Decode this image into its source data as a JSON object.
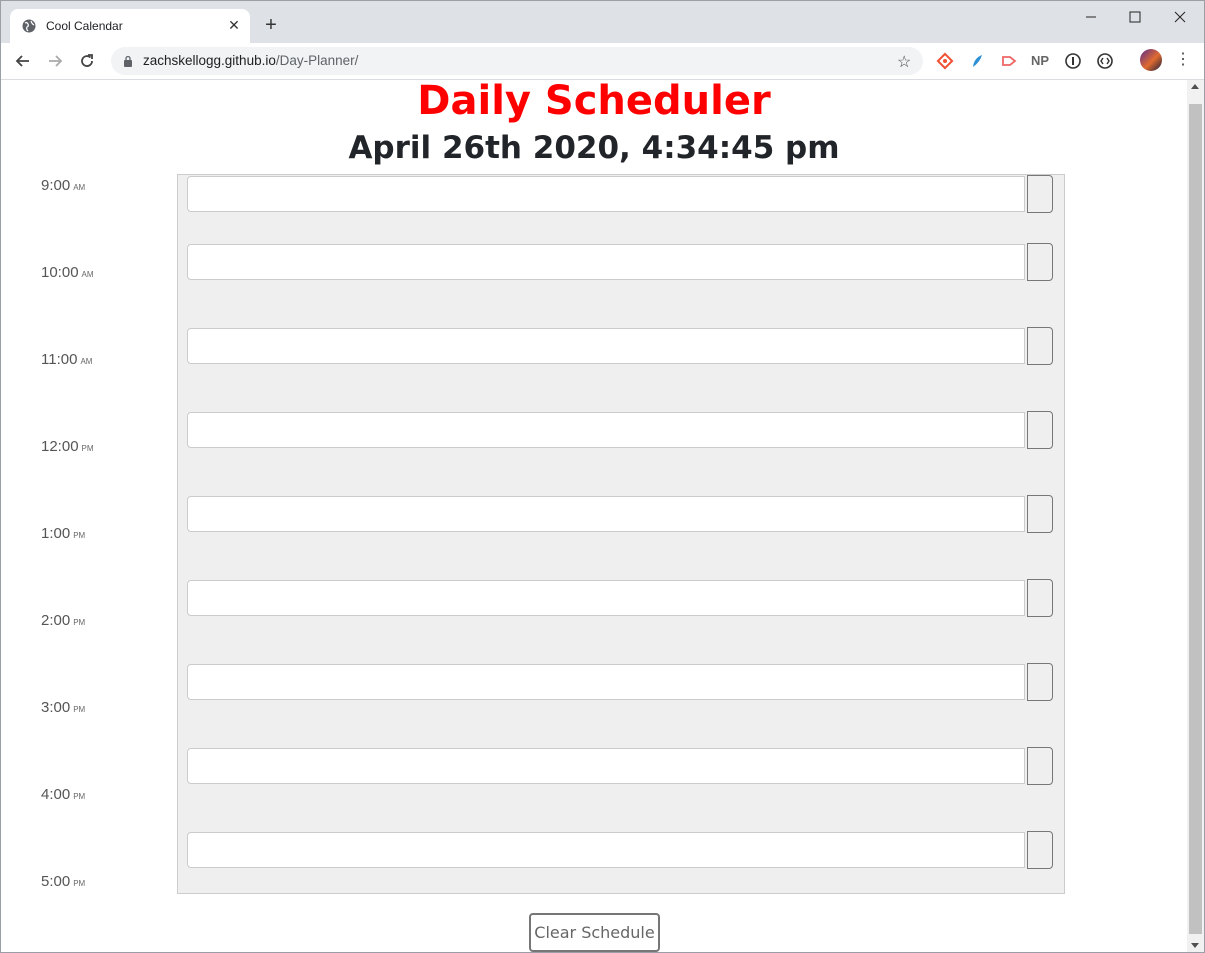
{
  "browser": {
    "tab_title": "Cool Calendar",
    "url_host": "zachskellogg.github.io",
    "url_path": "/Day-Planner/",
    "extensions": [
      "git-icon",
      "feather-icon",
      "arrow-ext-icon",
      "NP",
      "info-ext-icon",
      "code-ext-icon"
    ]
  },
  "page": {
    "title": "Daily Scheduler",
    "datetime": "April 26th 2020, 4:34:45 pm",
    "hours": [
      {
        "time": "9:00",
        "period": "AM"
      },
      {
        "time": "10:00",
        "period": "AM"
      },
      {
        "time": "11:00",
        "period": "AM"
      },
      {
        "time": "12:00",
        "period": "PM"
      },
      {
        "time": "1:00",
        "period": "PM"
      },
      {
        "time": "2:00",
        "period": "PM"
      },
      {
        "time": "3:00",
        "period": "PM"
      },
      {
        "time": "4:00",
        "period": "PM"
      },
      {
        "time": "5:00",
        "period": "PM"
      }
    ],
    "clear_label": "Clear Schedule"
  }
}
